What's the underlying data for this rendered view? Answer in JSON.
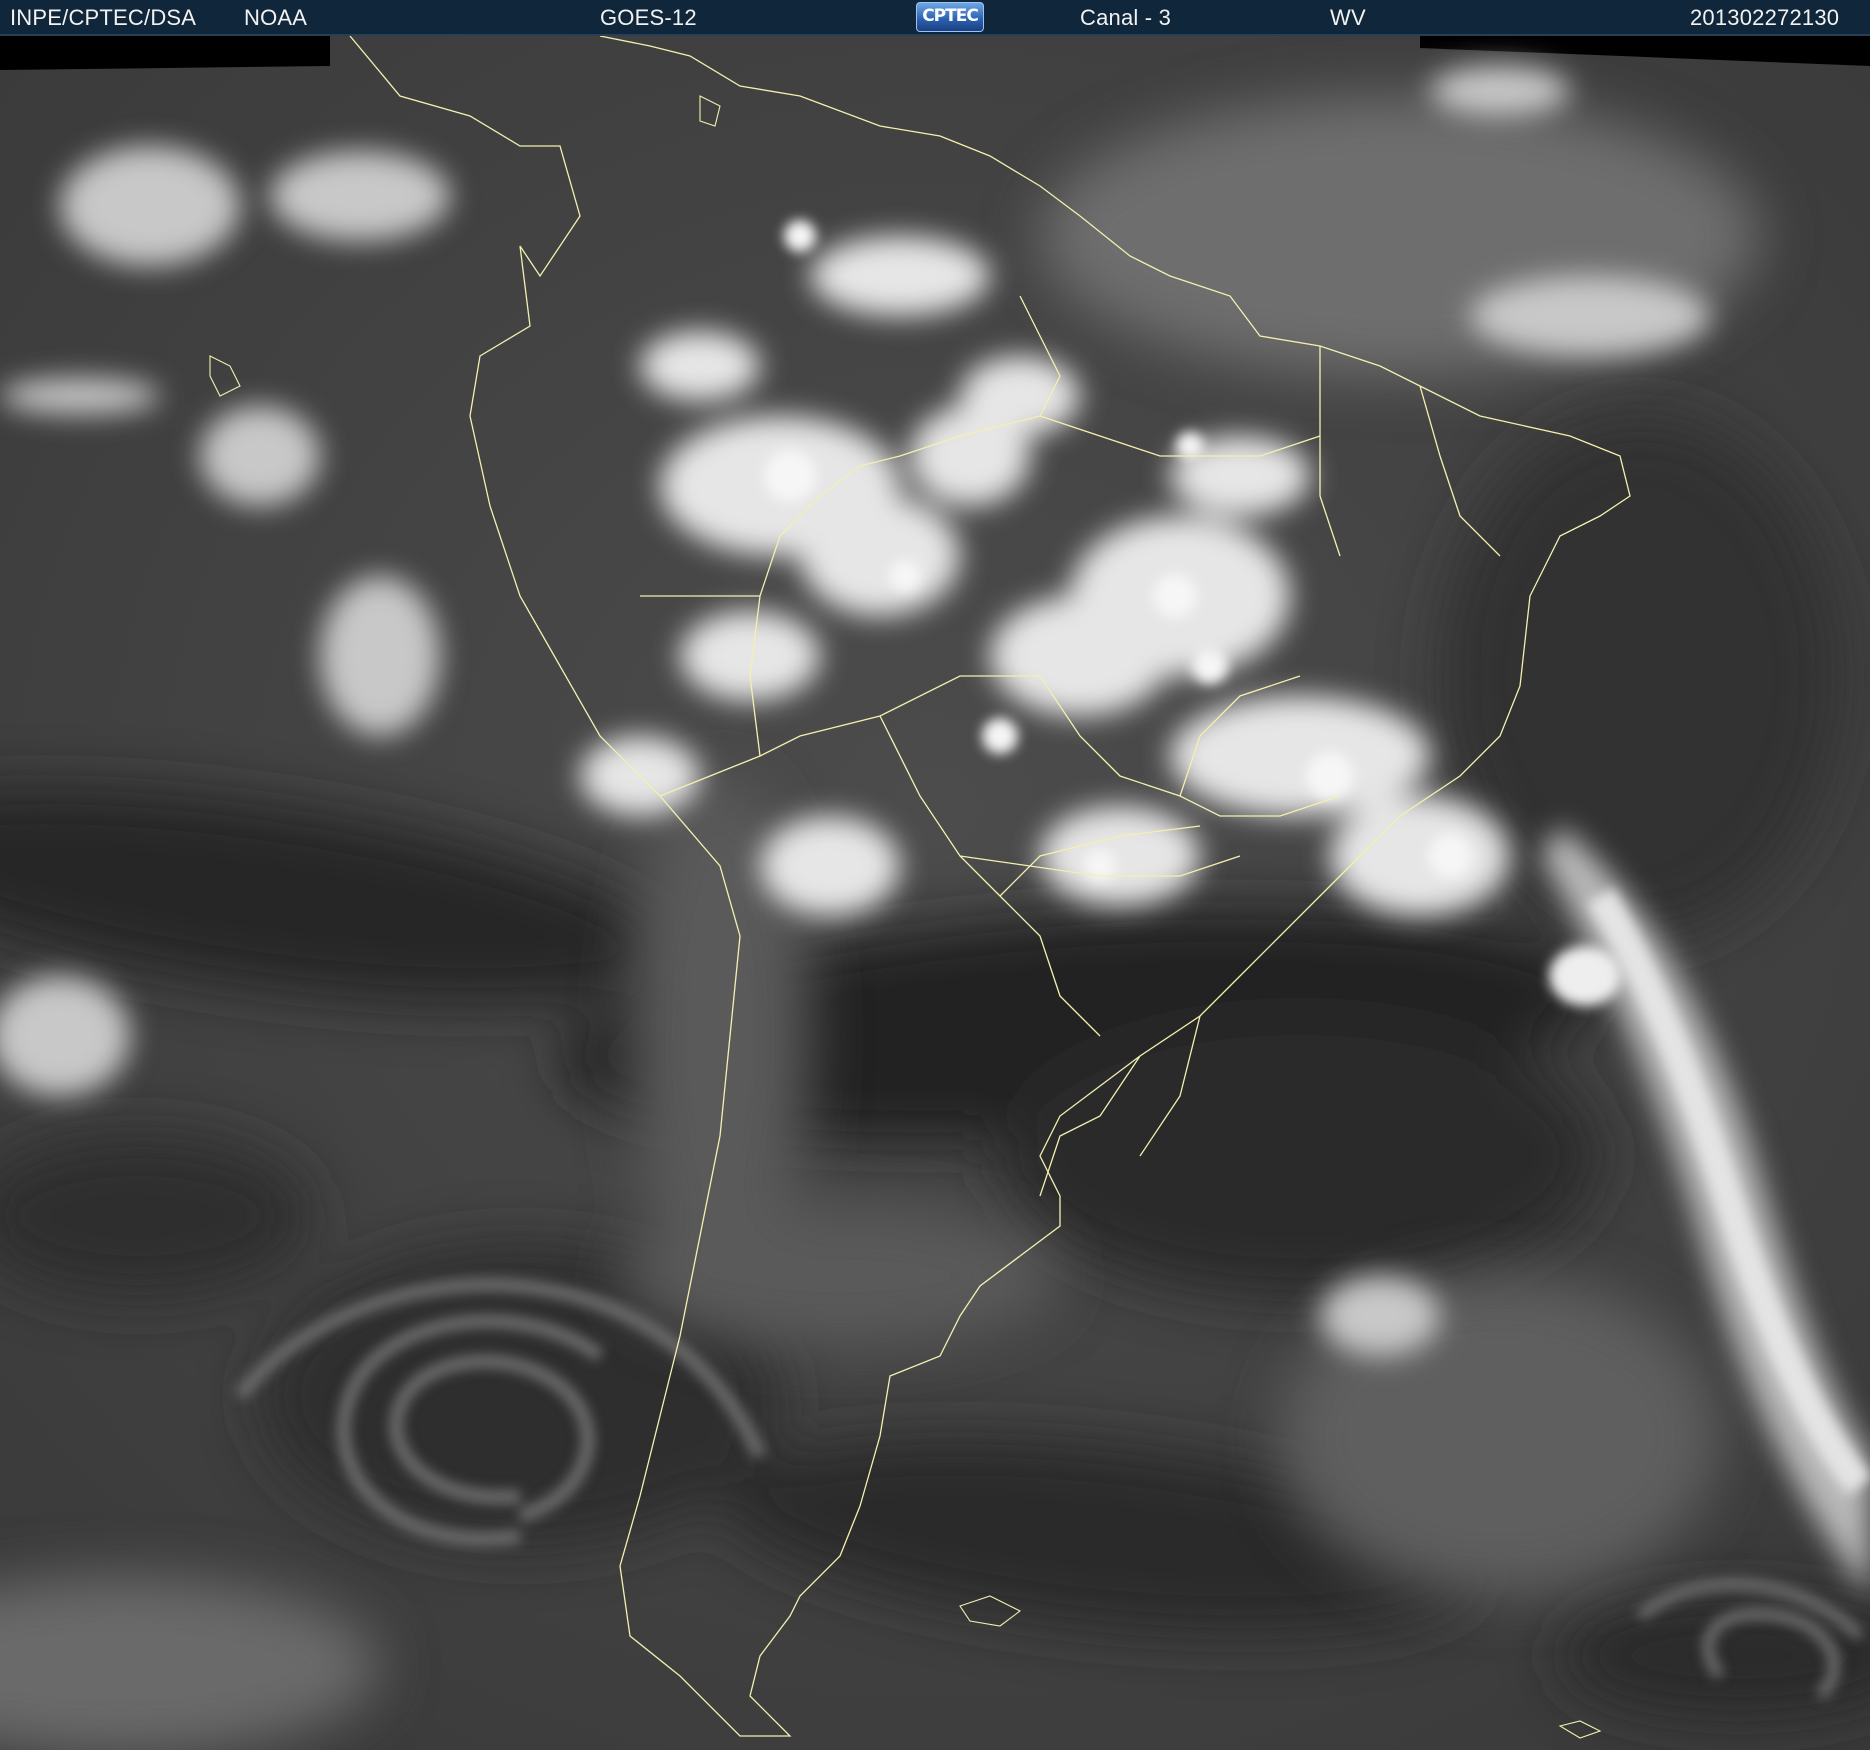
{
  "header": {
    "agency": "INPE/CPTEC/DSA",
    "partner": "NOAA",
    "satellite": "GOES-12",
    "logo_text": "CPTEC",
    "channel": "Canal - 3",
    "band": "WV",
    "timestamp": "201302272130"
  },
  "image": {
    "type": "satellite-water-vapor-image",
    "region": "South America",
    "colormap": "grayscale",
    "overlay_color": "#f3f0b0"
  }
}
